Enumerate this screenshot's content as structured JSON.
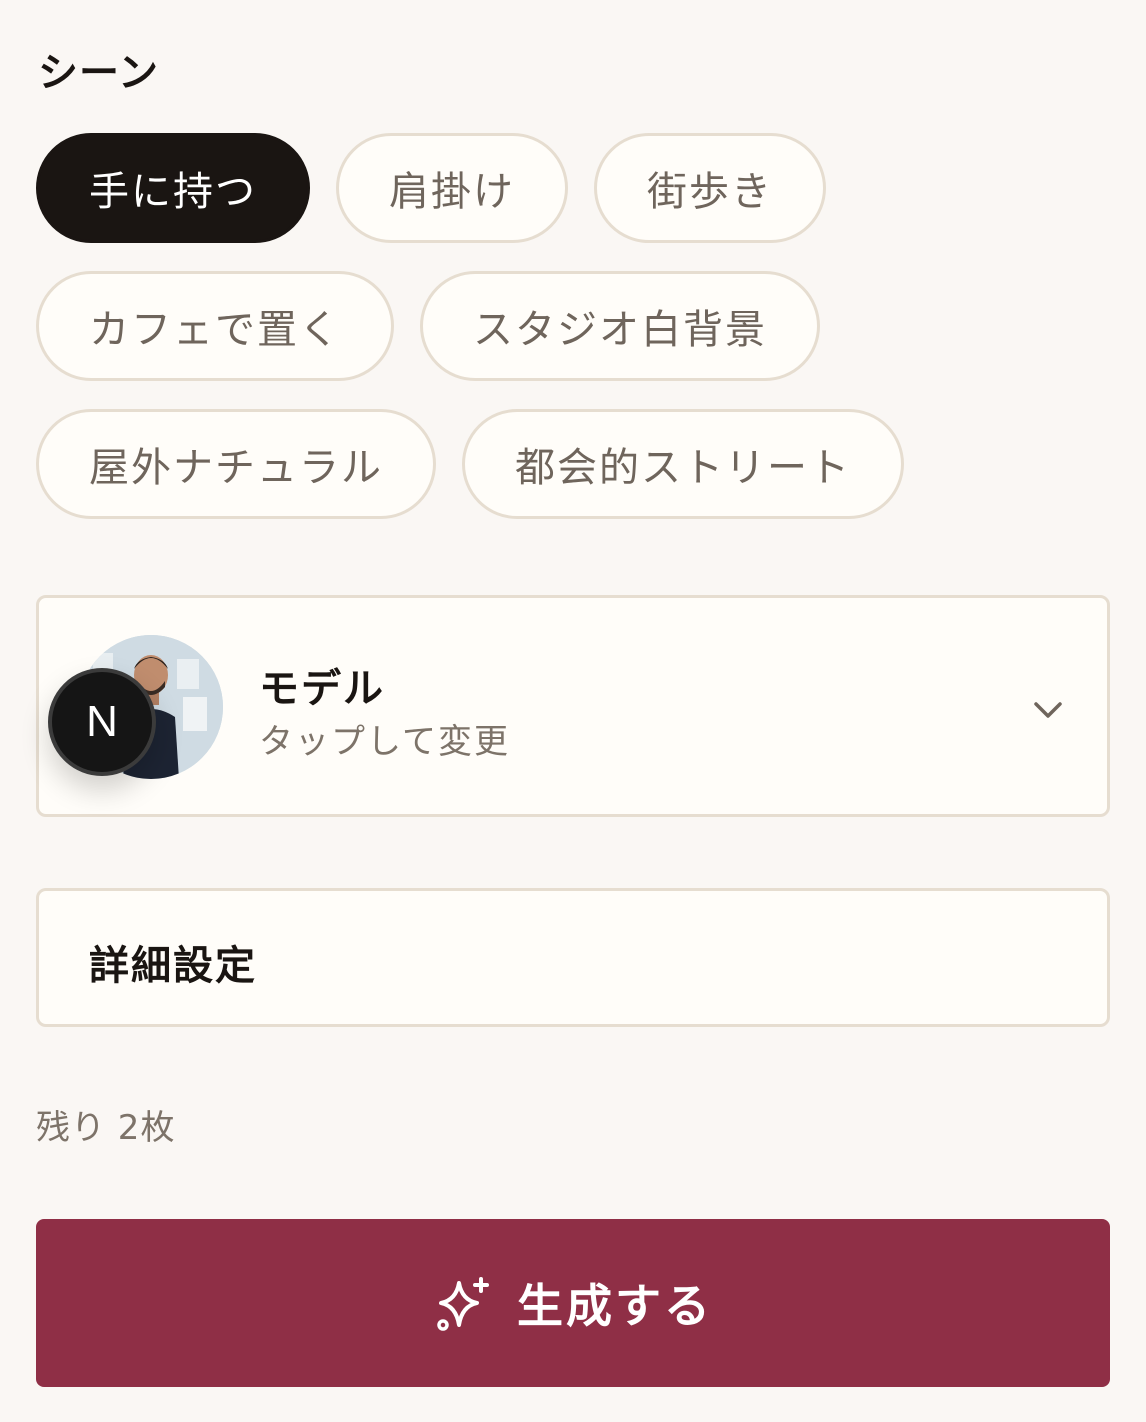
{
  "scene": {
    "title": "シーン",
    "options": [
      "手に持つ",
      "肩掛け",
      "街歩き",
      "カフェで置く",
      "スタジオ白背景",
      "屋外ナチュラル",
      "都会的ストリート"
    ],
    "selected": "手に持つ"
  },
  "model": {
    "title": "モデル",
    "subtitle": "タップして変更",
    "badge_letter": "N",
    "icons": {
      "expand": "chevron-down-icon"
    }
  },
  "details": {
    "label": "詳細設定"
  },
  "remaining": {
    "text": "残り 2枚"
  },
  "generate": {
    "label": "生成する",
    "icon": "sparkles-icon"
  },
  "colors": {
    "background": "#faf7f4",
    "chip_selected": "#1a1512",
    "chip_border": "#e6ddd0",
    "accent": "#8f2f46"
  }
}
